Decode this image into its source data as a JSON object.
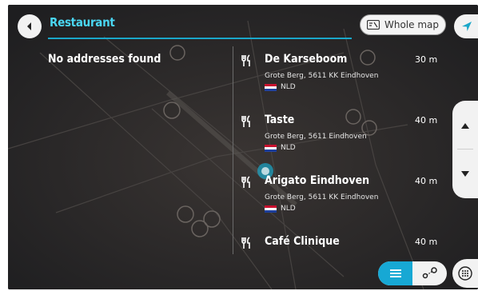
{
  "search": {
    "query": "Restaurant",
    "whole_map_label": "Whole map"
  },
  "left_panel": {
    "message": "No addresses found"
  },
  "results": [
    {
      "name": "De Karseboom",
      "address": "Grote Berg, 5611 KK Eindhoven",
      "country": "NLD",
      "distance": "30 m"
    },
    {
      "name": "Taste",
      "address": "Grote Berg, 5611 Eindhoven",
      "country": "NLD",
      "distance": "40 m"
    },
    {
      "name": "Arigato Eindhoven",
      "address": "Grote Berg, 5611 KK Eindhoven",
      "country": "NLD",
      "distance": "40 m"
    },
    {
      "name": "Café Clinique",
      "address": "",
      "country": "",
      "distance": "40 m"
    }
  ],
  "icons": {
    "back": "back-arrow-icon",
    "whole_map": "map-icon",
    "navigate": "navigation-arrow-icon",
    "restaurant": "fork-knife-icon",
    "scroll_up": "chevron-up-icon",
    "scroll_down": "chevron-down-icon",
    "list_view": "list-icon",
    "map_view": "route-icon",
    "keyboard": "keypad-icon"
  },
  "colors": {
    "accent": "#4ad6f2",
    "active_toggle": "#17a8d4",
    "background": "#262628"
  }
}
